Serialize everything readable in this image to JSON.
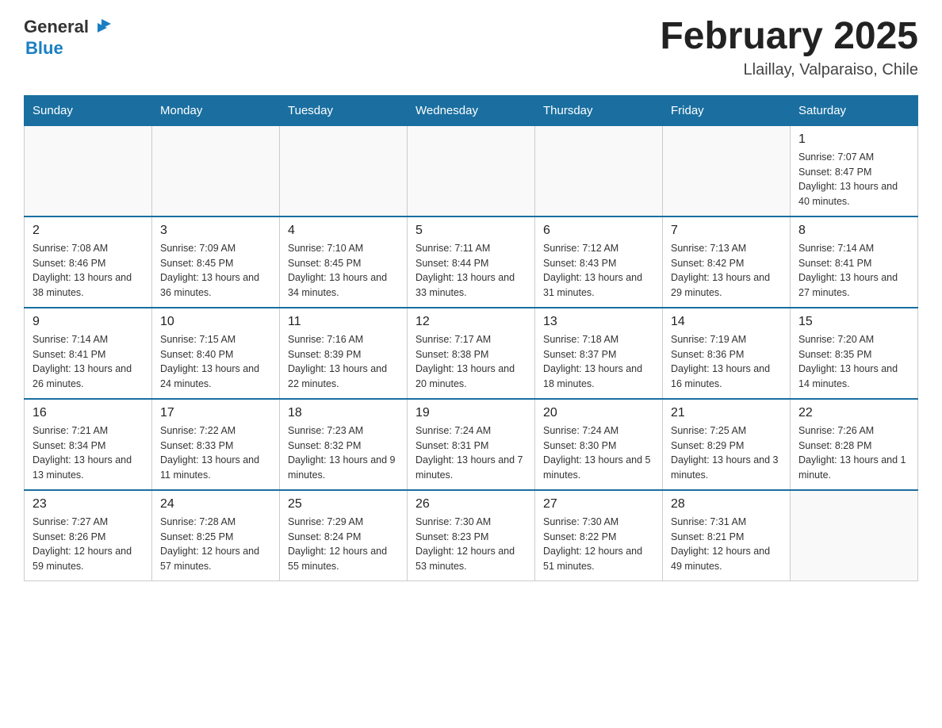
{
  "header": {
    "logo_general": "General",
    "logo_blue": "Blue",
    "title": "February 2025",
    "subtitle": "Llaillay, Valparaiso, Chile"
  },
  "weekdays": [
    "Sunday",
    "Monday",
    "Tuesday",
    "Wednesday",
    "Thursday",
    "Friday",
    "Saturday"
  ],
  "weeks": [
    [
      {
        "day": "",
        "info": ""
      },
      {
        "day": "",
        "info": ""
      },
      {
        "day": "",
        "info": ""
      },
      {
        "day": "",
        "info": ""
      },
      {
        "day": "",
        "info": ""
      },
      {
        "day": "",
        "info": ""
      },
      {
        "day": "1",
        "info": "Sunrise: 7:07 AM\nSunset: 8:47 PM\nDaylight: 13 hours and 40 minutes."
      }
    ],
    [
      {
        "day": "2",
        "info": "Sunrise: 7:08 AM\nSunset: 8:46 PM\nDaylight: 13 hours and 38 minutes."
      },
      {
        "day": "3",
        "info": "Sunrise: 7:09 AM\nSunset: 8:45 PM\nDaylight: 13 hours and 36 minutes."
      },
      {
        "day": "4",
        "info": "Sunrise: 7:10 AM\nSunset: 8:45 PM\nDaylight: 13 hours and 34 minutes."
      },
      {
        "day": "5",
        "info": "Sunrise: 7:11 AM\nSunset: 8:44 PM\nDaylight: 13 hours and 33 minutes."
      },
      {
        "day": "6",
        "info": "Sunrise: 7:12 AM\nSunset: 8:43 PM\nDaylight: 13 hours and 31 minutes."
      },
      {
        "day": "7",
        "info": "Sunrise: 7:13 AM\nSunset: 8:42 PM\nDaylight: 13 hours and 29 minutes."
      },
      {
        "day": "8",
        "info": "Sunrise: 7:14 AM\nSunset: 8:41 PM\nDaylight: 13 hours and 27 minutes."
      }
    ],
    [
      {
        "day": "9",
        "info": "Sunrise: 7:14 AM\nSunset: 8:41 PM\nDaylight: 13 hours and 26 minutes."
      },
      {
        "day": "10",
        "info": "Sunrise: 7:15 AM\nSunset: 8:40 PM\nDaylight: 13 hours and 24 minutes."
      },
      {
        "day": "11",
        "info": "Sunrise: 7:16 AM\nSunset: 8:39 PM\nDaylight: 13 hours and 22 minutes."
      },
      {
        "day": "12",
        "info": "Sunrise: 7:17 AM\nSunset: 8:38 PM\nDaylight: 13 hours and 20 minutes."
      },
      {
        "day": "13",
        "info": "Sunrise: 7:18 AM\nSunset: 8:37 PM\nDaylight: 13 hours and 18 minutes."
      },
      {
        "day": "14",
        "info": "Sunrise: 7:19 AM\nSunset: 8:36 PM\nDaylight: 13 hours and 16 minutes."
      },
      {
        "day": "15",
        "info": "Sunrise: 7:20 AM\nSunset: 8:35 PM\nDaylight: 13 hours and 14 minutes."
      }
    ],
    [
      {
        "day": "16",
        "info": "Sunrise: 7:21 AM\nSunset: 8:34 PM\nDaylight: 13 hours and 13 minutes."
      },
      {
        "day": "17",
        "info": "Sunrise: 7:22 AM\nSunset: 8:33 PM\nDaylight: 13 hours and 11 minutes."
      },
      {
        "day": "18",
        "info": "Sunrise: 7:23 AM\nSunset: 8:32 PM\nDaylight: 13 hours and 9 minutes."
      },
      {
        "day": "19",
        "info": "Sunrise: 7:24 AM\nSunset: 8:31 PM\nDaylight: 13 hours and 7 minutes."
      },
      {
        "day": "20",
        "info": "Sunrise: 7:24 AM\nSunset: 8:30 PM\nDaylight: 13 hours and 5 minutes."
      },
      {
        "day": "21",
        "info": "Sunrise: 7:25 AM\nSunset: 8:29 PM\nDaylight: 13 hours and 3 minutes."
      },
      {
        "day": "22",
        "info": "Sunrise: 7:26 AM\nSunset: 8:28 PM\nDaylight: 13 hours and 1 minute."
      }
    ],
    [
      {
        "day": "23",
        "info": "Sunrise: 7:27 AM\nSunset: 8:26 PM\nDaylight: 12 hours and 59 minutes."
      },
      {
        "day": "24",
        "info": "Sunrise: 7:28 AM\nSunset: 8:25 PM\nDaylight: 12 hours and 57 minutes."
      },
      {
        "day": "25",
        "info": "Sunrise: 7:29 AM\nSunset: 8:24 PM\nDaylight: 12 hours and 55 minutes."
      },
      {
        "day": "26",
        "info": "Sunrise: 7:30 AM\nSunset: 8:23 PM\nDaylight: 12 hours and 53 minutes."
      },
      {
        "day": "27",
        "info": "Sunrise: 7:30 AM\nSunset: 8:22 PM\nDaylight: 12 hours and 51 minutes."
      },
      {
        "day": "28",
        "info": "Sunrise: 7:31 AM\nSunset: 8:21 PM\nDaylight: 12 hours and 49 minutes."
      },
      {
        "day": "",
        "info": ""
      }
    ]
  ]
}
